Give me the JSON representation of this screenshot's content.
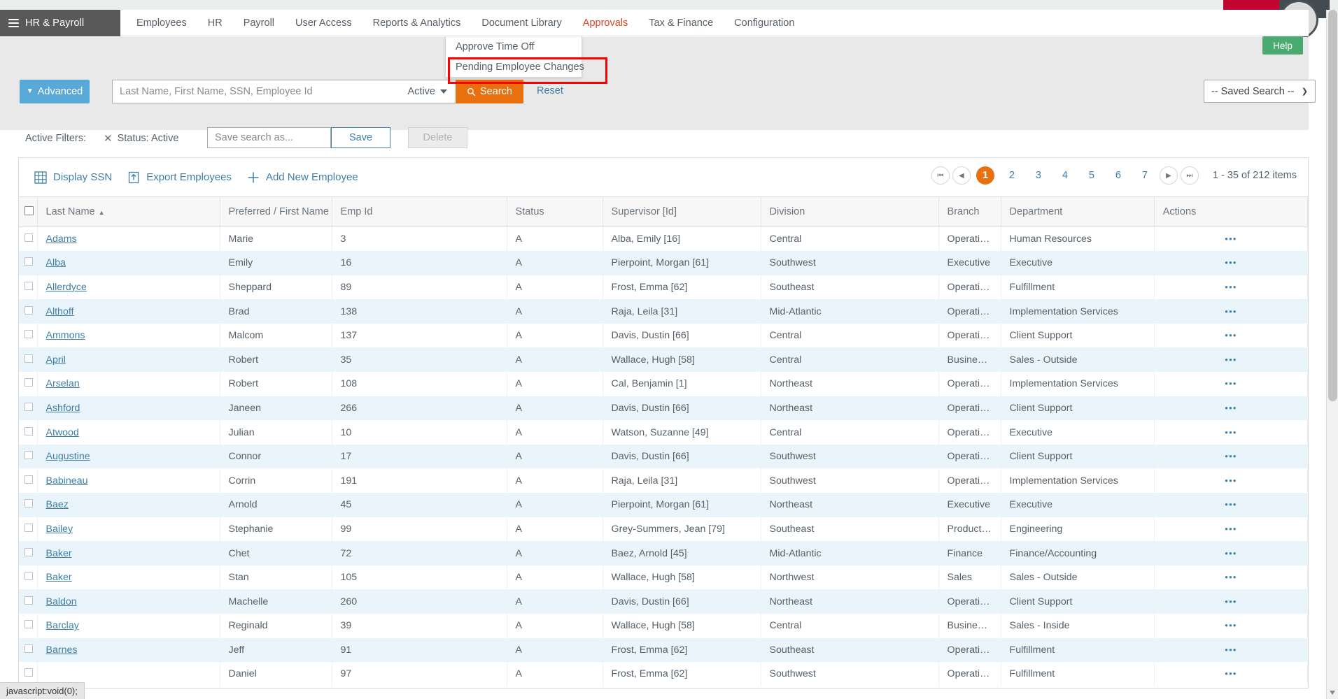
{
  "brand": {
    "label": "HR & Payroll",
    "icon": "hamburger-icon"
  },
  "nav": {
    "items": [
      {
        "label": "Employees",
        "active": false
      },
      {
        "label": "HR",
        "active": false
      },
      {
        "label": "Payroll",
        "active": false
      },
      {
        "label": "User Access",
        "active": false
      },
      {
        "label": "Reports & Analytics",
        "active": false
      },
      {
        "label": "Document Library",
        "active": false
      },
      {
        "label": "Approvals",
        "active": true
      },
      {
        "label": "Tax & Finance",
        "active": false
      },
      {
        "label": "Configuration",
        "active": false
      }
    ]
  },
  "dropdown": {
    "items": [
      {
        "label": "Approve Time Off",
        "highlighted": false
      },
      {
        "label": "Pending Employee Changes",
        "highlighted": true
      }
    ]
  },
  "search": {
    "advanced_label": "Advanced",
    "placeholder": "Last Name, First Name, SSN, Employee Id",
    "value": "",
    "status_value": "Active",
    "search_label": "Search",
    "reset_label": "Reset",
    "saved_search_label": "-- Saved Search --",
    "help_label": "Help"
  },
  "filters": {
    "label": "Active Filters:",
    "chip": "Status: Active",
    "save_placeholder": "Save search as...",
    "save_value": "",
    "save_label": "Save",
    "delete_label": "Delete"
  },
  "toolbar": {
    "display_ssn": "Display SSN",
    "export_employees": "Export Employees",
    "add_new_employee": "Add New Employee"
  },
  "pager": {
    "pages": [
      "1",
      "2",
      "3",
      "4",
      "5",
      "6",
      "7"
    ],
    "current": "1",
    "info": "1 - 35 of 212 items"
  },
  "table": {
    "columns": [
      "Last Name",
      "Preferred / First Name",
      "Emp Id",
      "Status",
      "Supervisor [Id]",
      "Division",
      "Branch",
      "Department",
      "Actions"
    ],
    "sort_column": "Last Name",
    "sort_direction": "asc",
    "rows": [
      {
        "last": "Adams",
        "first": "Marie",
        "emp": "3",
        "status": "A",
        "supervisor": "Alba, Emily [16]",
        "division": "Central",
        "branch": "Operations",
        "department": "Human Resources"
      },
      {
        "last": "Alba",
        "first": "Emily",
        "emp": "16",
        "status": "A",
        "supervisor": "Pierpoint, Morgan [61]",
        "division": "Southwest",
        "branch": "Executive",
        "department": "Executive"
      },
      {
        "last": "Allerdyce",
        "first": "Sheppard",
        "emp": "89",
        "status": "A",
        "supervisor": "Frost, Emma [62]",
        "division": "Southeast",
        "branch": "Operations",
        "department": "Fulfillment"
      },
      {
        "last": "Althoff",
        "first": "Brad",
        "emp": "138",
        "status": "A",
        "supervisor": "Raja, Leila [31]",
        "division": "Mid-Atlantic",
        "branch": "Operations",
        "department": "Implementation Services"
      },
      {
        "last": "Ammons",
        "first": "Malcom",
        "emp": "137",
        "status": "A",
        "supervisor": "Davis, Dustin [66]",
        "division": "Central",
        "branch": "Operations",
        "department": "Client Support"
      },
      {
        "last": "April",
        "first": "Robert",
        "emp": "35",
        "status": "A",
        "supervisor": "Wallace, Hugh [58]",
        "division": "Central",
        "branch": "Business Development",
        "department": "Sales - Outside"
      },
      {
        "last": "Arselan",
        "first": "Robert",
        "emp": "108",
        "status": "A",
        "supervisor": "Cal, Benjamin [1]",
        "division": "Northeast",
        "branch": "Operations",
        "department": "Implementation Services"
      },
      {
        "last": "Ashford",
        "first": "Janeen",
        "emp": "266",
        "status": "A",
        "supervisor": "Davis, Dustin [66]",
        "division": "Northeast",
        "branch": "Operations",
        "department": "Client Support"
      },
      {
        "last": "Atwood",
        "first": "Julian",
        "emp": "10",
        "status": "A",
        "supervisor": "Watson, Suzanne [49]",
        "division": "Central",
        "branch": "Operations",
        "department": "Executive"
      },
      {
        "last": "Augustine",
        "first": "Connor",
        "emp": "17",
        "status": "A",
        "supervisor": "Davis, Dustin [66]",
        "division": "Southwest",
        "branch": "Operations",
        "department": "Client Support"
      },
      {
        "last": "Babineau",
        "first": "Corrin",
        "emp": "191",
        "status": "A",
        "supervisor": "Raja, Leila [31]",
        "division": "Southwest",
        "branch": "Operations",
        "department": "Implementation Services"
      },
      {
        "last": "Baez",
        "first": "Arnold",
        "emp": "45",
        "status": "A",
        "supervisor": "Pierpoint, Morgan [61]",
        "division": "Northeast",
        "branch": "Executive",
        "department": "Executive"
      },
      {
        "last": "Bailey",
        "first": "Stephanie",
        "emp": "99",
        "status": "A",
        "supervisor": "Grey-Summers, Jean [79]",
        "division": "Southeast",
        "branch": "Product Development",
        "department": "Engineering"
      },
      {
        "last": "Baker",
        "first": "Chet",
        "emp": "72",
        "status": "A",
        "supervisor": "Baez, Arnold [45]",
        "division": "Mid-Atlantic",
        "branch": "Finance",
        "department": "Finance/Accounting"
      },
      {
        "last": "Baker",
        "first": "Stan",
        "emp": "105",
        "status": "A",
        "supervisor": "Wallace, Hugh [58]",
        "division": "Northwest",
        "branch": "Sales",
        "department": "Sales - Outside"
      },
      {
        "last": "Baldon",
        "first": "Machelle",
        "emp": "260",
        "status": "A",
        "supervisor": "Davis, Dustin [66]",
        "division": "Northeast",
        "branch": "Operations",
        "department": "Client Support"
      },
      {
        "last": "Barclay",
        "first": "Reginald",
        "emp": "39",
        "status": "A",
        "supervisor": "Wallace, Hugh [58]",
        "division": "Central",
        "branch": "Business Development",
        "department": "Sales - Inside"
      },
      {
        "last": "Barnes",
        "first": "Jeff",
        "emp": "91",
        "status": "A",
        "supervisor": "Frost, Emma [62]",
        "division": "Southeast",
        "branch": "Operations",
        "department": "Fulfillment"
      },
      {
        "last": "",
        "first": "Daniel",
        "emp": "97",
        "status": "A",
        "supervisor": "Frost, Emma [62]",
        "division": "Southwest",
        "branch": "Operations",
        "department": "Fulfillment"
      }
    ],
    "actions_glyph": "●●●"
  },
  "statusbar": {
    "text": "javascript:void(0);"
  },
  "colors": {
    "accent_orange": "#e8700f",
    "link_blue": "#3f7fa6",
    "brand_gray": "#595959",
    "help_green": "#4aaa6f",
    "advanced_blue": "#58a9d8",
    "highlight_red": "#ff0000",
    "active_nav_red": "#d9451f",
    "alt_row_blue": "#eaf4fb"
  }
}
